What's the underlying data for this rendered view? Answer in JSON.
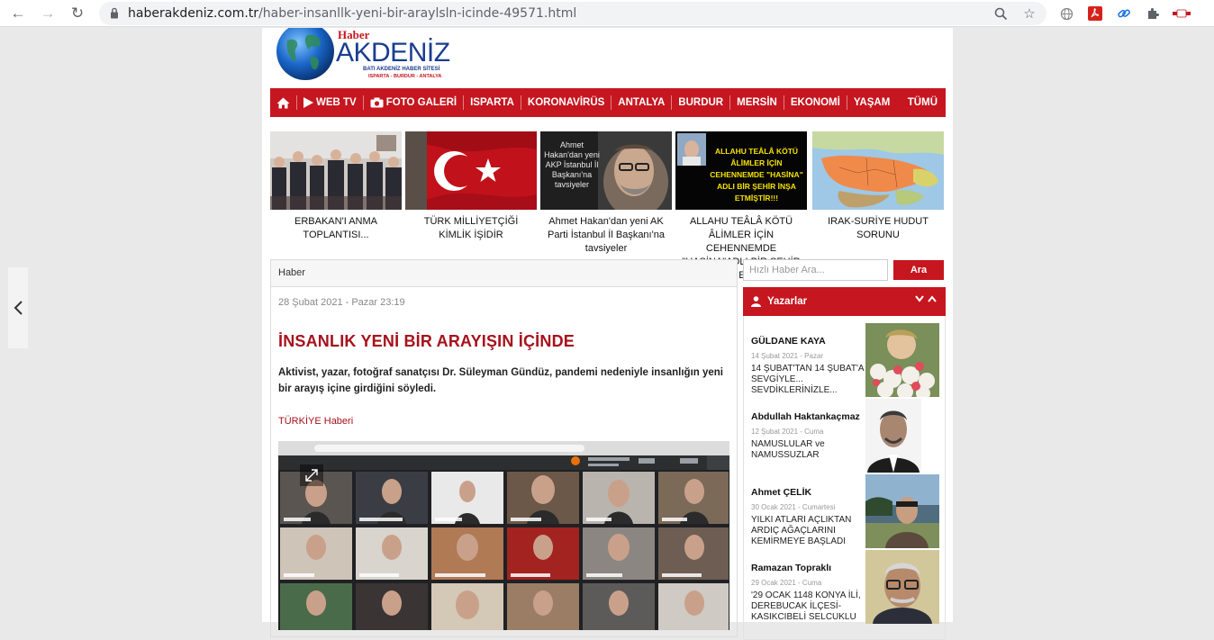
{
  "browser": {
    "url_host": "haberakdeniz.com.tr",
    "url_path": "/haber-insanllk-yeni-bir-araylsln-icinde-49571.html"
  },
  "logo": {
    "haber": "Haber",
    "brand": "AKDENİZ",
    "tagline": "BATI AKDENİZ HABER SİTESİ",
    "cities": "ISPARTA - BURDUR - ANTALYA"
  },
  "nav": {
    "items": [
      "WEB TV",
      "FOTO GALERİ",
      "ISPARTA",
      "KORONAVİRÜS",
      "ANTALYA",
      "BURDUR",
      "MERSİN",
      "EKONOMİ",
      "YAŞAM"
    ],
    "all": "TÜMÜ"
  },
  "slider": [
    {
      "caption": "ERBAKAN'I ANMA TOPLANTISI..."
    },
    {
      "caption": "TÜRK MİLLİYETÇİĞİ KİMLİK İŞİDİR"
    },
    {
      "caption": "Ahmet Hakan'dan yeni AK Parti İstanbul İl Başkanı'na tavsiyeler",
      "thumb_text": "Ahmet Hakan'dan yeni AKP İstanbul İl Başkanı'na tavsiyeler"
    },
    {
      "caption": "ALLAHU TEÂLÂ KÖTÜ ÂLİMLER İÇİN CEHENNEMDE \"HASİNA\"ADLI BİR ŞEHİR İNŞA ETMİŞ",
      "thumb_text": "ALLAHU TEÂLÂ KÖTÜ ÂLİMLER İÇİN CEHENNEMDE \"HASİNA\" ADLI BİR ŞEHİR İNŞA ETMİŞTİR!!!"
    },
    {
      "caption": "IRAK-SURİYE HUDUT SORUNU"
    }
  ],
  "article": {
    "breadcrumb": "Haber",
    "date": "28 Şubat 2021 - Pazar 23:19",
    "title": "İNSANLIK YENİ BİR ARAYIŞIN İÇİNDE",
    "lead": "Aktivist, yazar, fotoğraf sanatçısı Dr. Süleyman Gündüz, pandemi nedeniyle insanlığın yeni bir arayış içine girdiğini söyledi.",
    "category": "TÜRKİYE",
    "category_suffix": "Haberi"
  },
  "sidebar": {
    "search_placeholder": "Hızlı Haber Ara...",
    "search_button": "Ara",
    "yazarlar_title": "Yazarlar",
    "yazarlar": [
      {
        "name": "GÜLDANE KAYA",
        "date": "14 Şubat 2021 - Pazar",
        "title": "14 ŞUBAT'TAN 14 ŞUBAT'A SEVGİYLE... SEVDİKLERİNİZLE..."
      },
      {
        "name": "Abdullah Haktankaçmaz",
        "date": "12 Şubat 2021 - Cuma",
        "title": "NAMUSLULAR ve NAMUSSUZLAR"
      },
      {
        "name": "Ahmet ÇELİK",
        "date": "30 Ocak 2021 - Cumartesi",
        "title": "YILKI ATLARI AÇLIKTAN ARDIÇ AĞAÇLARINI KEMİRMEYE BAŞLADI"
      },
      {
        "name": "Ramazan Topraklı",
        "date": "29 Ocak 2021 - Cuma",
        "title": "'29 OCAK 1148 KONYA İLİ, DEREBUCAK İLÇESİ-KASIKCIBELİ SELCUKLU"
      }
    ]
  },
  "colors": {
    "brand_red": "#c6161f",
    "title_red": "#a6121c"
  }
}
